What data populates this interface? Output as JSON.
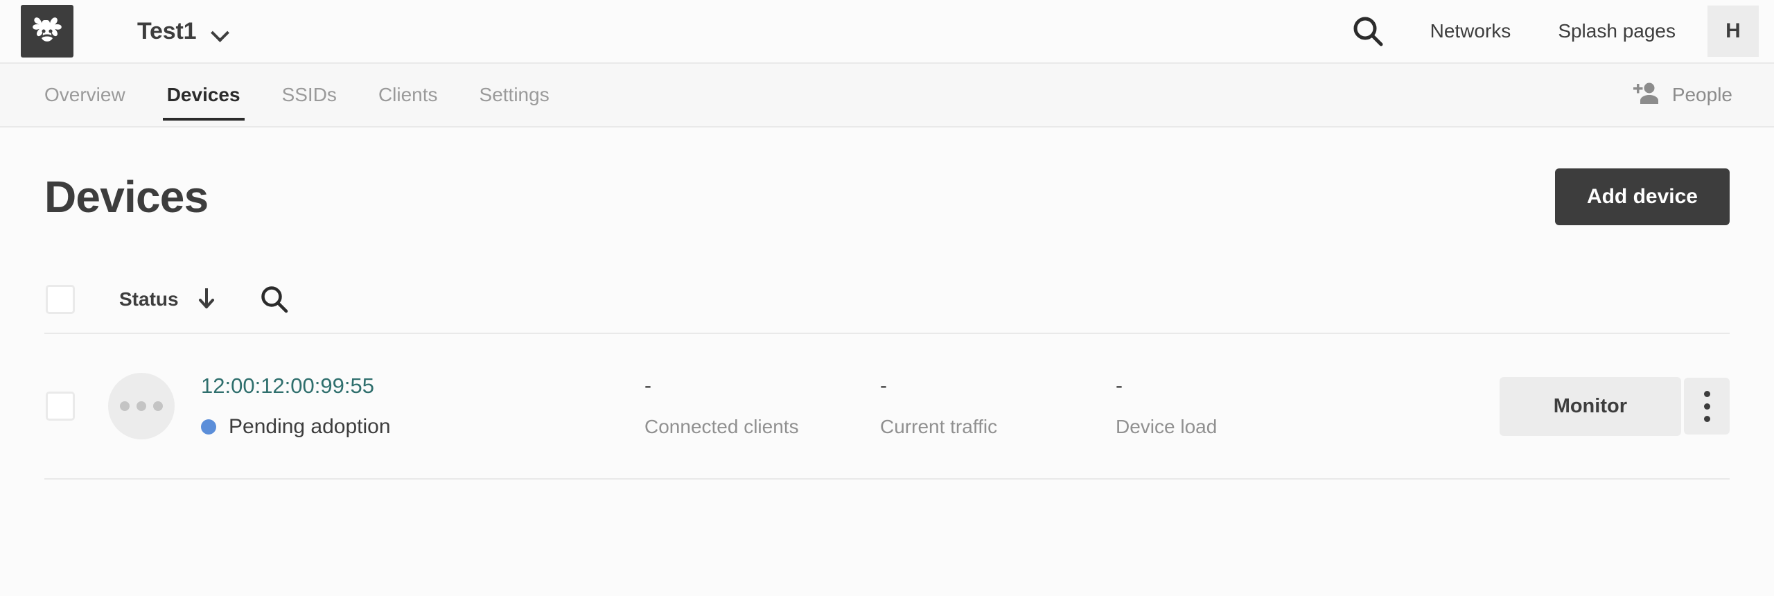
{
  "topbar": {
    "logo_icon": "meraki-logo-icon",
    "org_name": "Test1",
    "org_chevron_icon": "chevron-down-icon",
    "search_icon": "search-icon",
    "links": [
      {
        "label": "Networks"
      },
      {
        "label": "Splash pages"
      }
    ],
    "user_initial": "H"
  },
  "subnav": {
    "tabs": [
      {
        "label": "Overview",
        "active": false
      },
      {
        "label": "Devices",
        "active": true
      },
      {
        "label": "SSIDs",
        "active": false
      },
      {
        "label": "Clients",
        "active": false
      },
      {
        "label": "Settings",
        "active": false
      }
    ],
    "people": {
      "icon": "person-add-icon",
      "label": "People"
    }
  },
  "page": {
    "title": "Devices",
    "add_device_label": "Add device"
  },
  "table": {
    "select_all_checkbox": "unchecked",
    "sort_column_label": "Status",
    "sort_direction_icon": "arrow-down-icon",
    "search_icon": "search-icon",
    "rows": [
      {
        "checkbox": "unchecked",
        "avatar_icon": "device-placeholder-icon",
        "name": "12:00:12:00:99:55",
        "status_text": "Pending adoption",
        "status_color": "#5b8ed9",
        "metrics": [
          {
            "value": "-",
            "label": "Connected clients"
          },
          {
            "value": "-",
            "label": "Current traffic"
          },
          {
            "value": "-",
            "label": "Device load"
          }
        ],
        "monitor_label": "Monitor",
        "kebab_icon": "more-vertical-icon"
      }
    ]
  },
  "colors": {
    "page_bg": "#fbfbfb",
    "subnav_bg": "#f7f7f7",
    "primary_dark": "#3d3d3d",
    "link_teal": "#2f6f6d",
    "status_blue": "#5b8ed9",
    "border": "#e9e9e9",
    "muted_text": "#909090"
  }
}
